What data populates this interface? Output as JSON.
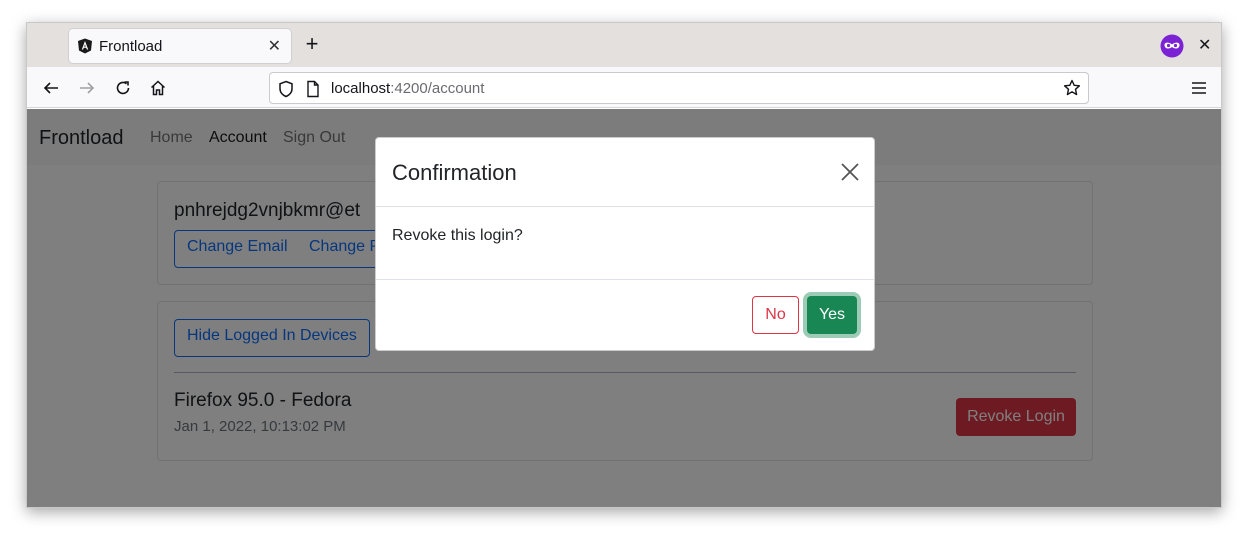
{
  "browser": {
    "tab_title": "Frontload",
    "tab_close": "✕",
    "new_tab": "+",
    "window_close": "✕",
    "url_host": "localhost",
    "url_path": ":4200/account"
  },
  "site": {
    "brand": "Frontload",
    "nav": [
      "Home",
      "Account",
      "Sign Out"
    ],
    "active_nav": "Account"
  },
  "account": {
    "email": "pnhrejdg2vnjbkmr@et",
    "change_email_label": "Change Email",
    "change_password_label": "Change P"
  },
  "devices": {
    "toggle_label": "Hide Logged In Devices",
    "items": [
      {
        "name": "Firefox 95.0 - Fedora",
        "time": "Jan 1, 2022, 10:13:02 PM",
        "revoke_label": "Revoke Login"
      }
    ]
  },
  "modal": {
    "title": "Confirmation",
    "message": "Revoke this login?",
    "no_label": "No",
    "yes_label": "Yes"
  },
  "colors": {
    "primary": "#0d6efd",
    "danger": "#dc3545",
    "success": "#198754",
    "backdrop": "rgba(0,0,0,0.5)",
    "extension": "#7b22d4"
  }
}
